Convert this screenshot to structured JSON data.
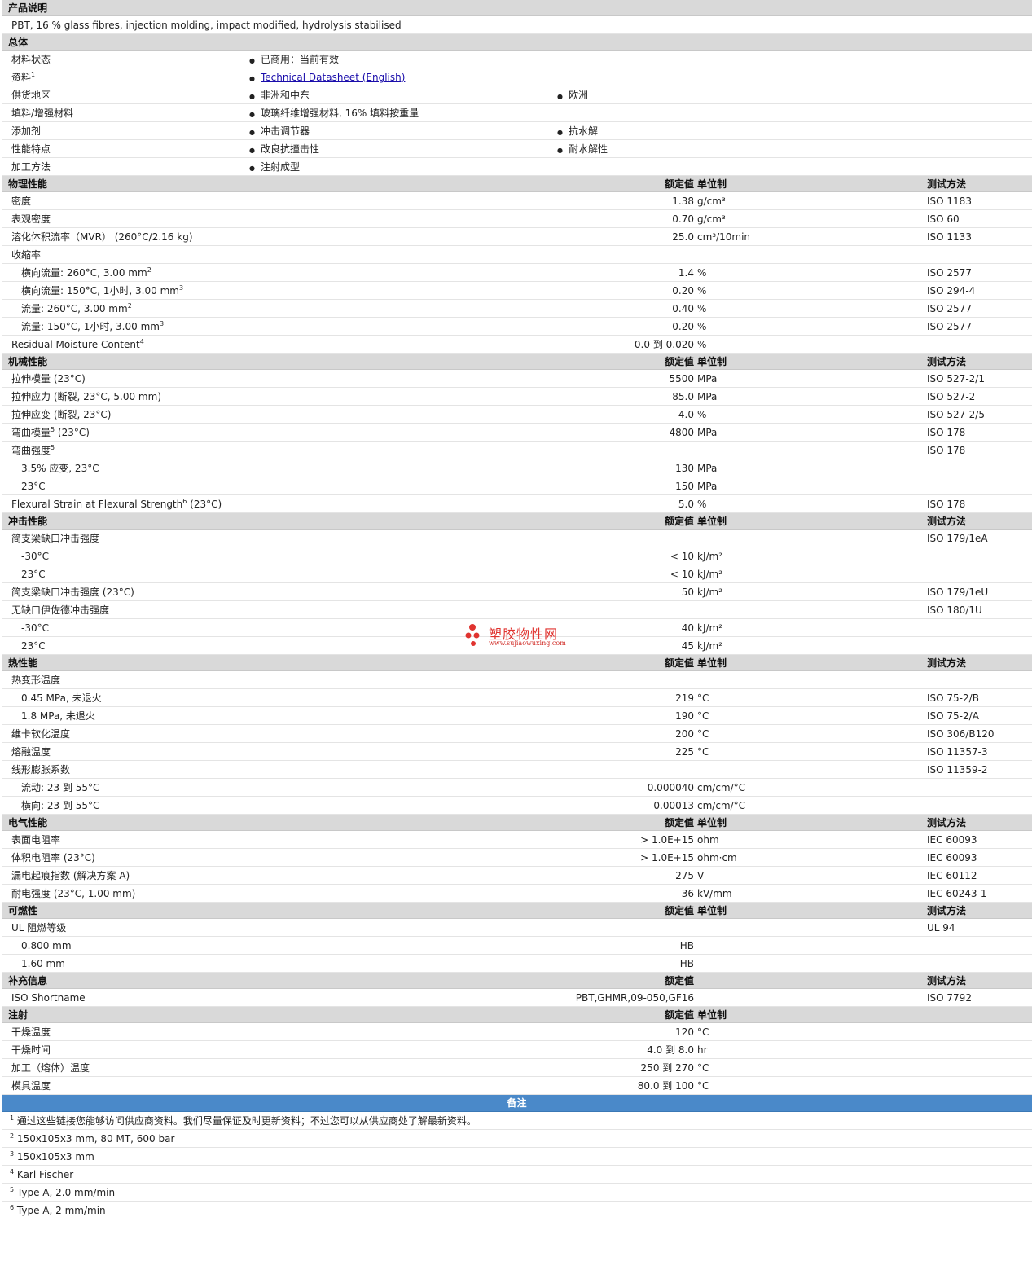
{
  "sections": [
    {
      "type": "section",
      "title": "产品说明"
    },
    {
      "type": "text",
      "text": "PBT, 16 % glass fibres, injection molding, impact modified, hydrolysis stabilised"
    },
    {
      "type": "section",
      "title": "总体"
    },
    {
      "type": "general",
      "label": "材料状态",
      "b1": "已商用：当前有效"
    },
    {
      "type": "general",
      "label": "资料",
      "sup": "1",
      "b1": "Technical Datasheet (English)",
      "link": true
    },
    {
      "type": "general",
      "label": "供货地区",
      "b1": "非洲和中东",
      "b2": "欧洲"
    },
    {
      "type": "general",
      "label": "填料/增强材料",
      "b1": "玻璃纤维增强材料, 16% 填料按重量"
    },
    {
      "type": "general",
      "label": "添加剂",
      "b1": "冲击调节器",
      "b2": "抗水解"
    },
    {
      "type": "general",
      "label": "性能特点",
      "b1": "改良抗撞击性",
      "b2": "耐水解性"
    },
    {
      "type": "general",
      "label": "加工方法",
      "b1": "注射成型"
    },
    {
      "type": "section",
      "title": "物理性能",
      "val": "额定值",
      "unit": "单位制",
      "test": "测试方法"
    },
    {
      "type": "prop",
      "label": "密度",
      "val": "1.38",
      "unit": "g/cm³",
      "test": "ISO 1183"
    },
    {
      "type": "prop",
      "label": "表观密度",
      "val": "0.70",
      "unit": "g/cm³",
      "test": "ISO 60"
    },
    {
      "type": "prop",
      "label": "溶化体积流率（MVR） (260°C/2.16 kg)",
      "val": "25.0",
      "unit": "cm³/10min",
      "test": "ISO 1133"
    },
    {
      "type": "prop",
      "label": "收缩率"
    },
    {
      "type": "prop",
      "sub": true,
      "label": "横向流量: 260°C, 3.00 mm",
      "sup": "2",
      "val": "1.4",
      "unit": "%",
      "test": "ISO 2577"
    },
    {
      "type": "prop",
      "sub": true,
      "label": "横向流量: 150°C, 1小时, 3.00 mm",
      "sup": "3",
      "val": "0.20",
      "unit": "%",
      "test": "ISO 294-4"
    },
    {
      "type": "prop",
      "sub": true,
      "label": "流量: 260°C, 3.00 mm",
      "sup": "2",
      "val": "0.40",
      "unit": "%",
      "test": "ISO 2577"
    },
    {
      "type": "prop",
      "sub": true,
      "label": "流量: 150°C, 1小时, 3.00 mm",
      "sup": "3",
      "val": "0.20",
      "unit": "%",
      "test": "ISO 2577"
    },
    {
      "type": "prop",
      "label": "Residual Moisture Content",
      "sup": "4",
      "val": "0.0 到  0.020",
      "unit": "%"
    },
    {
      "type": "section",
      "title": "机械性能",
      "val": "额定值",
      "unit": "单位制",
      "test": "测试方法"
    },
    {
      "type": "prop",
      "label": "拉伸模量 (23°C)",
      "val": "5500",
      "unit": "MPa",
      "test": "ISO 527-2/1"
    },
    {
      "type": "prop",
      "label": "拉伸应力 (断裂, 23°C, 5.00 mm)",
      "val": "85.0",
      "unit": "MPa",
      "test": "ISO 527-2"
    },
    {
      "type": "prop",
      "label": "拉伸应变 (断裂, 23°C)",
      "val": "4.0",
      "unit": "%",
      "test": "ISO 527-2/5"
    },
    {
      "type": "prop",
      "label": "弯曲模量",
      "sup": "5",
      "after": " (23°C)",
      "val": "4800",
      "unit": "MPa",
      "test": "ISO 178"
    },
    {
      "type": "prop",
      "label": "弯曲强度",
      "sup": "5",
      "test": "ISO 178"
    },
    {
      "type": "prop",
      "sub": true,
      "label": "3.5% 应变, 23°C",
      "val": "130",
      "unit": "MPa"
    },
    {
      "type": "prop",
      "sub": true,
      "label": "23°C",
      "val": "150",
      "unit": "MPa"
    },
    {
      "type": "prop",
      "label": "Flexural Strain at Flexural Strength",
      "sup": "6",
      "after": " (23°C)",
      "val": "5.0",
      "unit": "%",
      "test": "ISO 178"
    },
    {
      "type": "section",
      "title": "冲击性能",
      "val": "额定值",
      "unit": "单位制",
      "test": "测试方法"
    },
    {
      "type": "prop",
      "label": "简支梁缺口冲击强度",
      "test": "ISO 179/1eA"
    },
    {
      "type": "prop",
      "sub": true,
      "label": "-30°C",
      "val": "< 10",
      "unit": "kJ/m²"
    },
    {
      "type": "prop",
      "sub": true,
      "label": "23°C",
      "val": "< 10",
      "unit": "kJ/m²"
    },
    {
      "type": "prop",
      "label": "简支梁缺口冲击强度 (23°C)",
      "val": "50",
      "unit": "kJ/m²",
      "test": "ISO 179/1eU"
    },
    {
      "type": "prop",
      "label": "无缺口伊佐德冲击强度",
      "test": "ISO 180/1U"
    },
    {
      "type": "prop",
      "sub": true,
      "label": "-30°C",
      "val": "40",
      "unit": "kJ/m²"
    },
    {
      "type": "prop",
      "sub": true,
      "label": "23°C",
      "val": "45",
      "unit": "kJ/m²"
    },
    {
      "type": "section",
      "title": "热性能",
      "val": "额定值",
      "unit": "单位制",
      "test": "测试方法"
    },
    {
      "type": "prop",
      "label": "热变形温度"
    },
    {
      "type": "prop",
      "sub": true,
      "label": "0.45 MPa, 未退火",
      "val": "219",
      "unit": "°C",
      "test": "ISO 75-2/B"
    },
    {
      "type": "prop",
      "sub": true,
      "label": "1.8 MPa, 未退火",
      "val": "190",
      "unit": "°C",
      "test": "ISO 75-2/A"
    },
    {
      "type": "prop",
      "label": "维卡软化温度",
      "val": "200",
      "unit": "°C",
      "test": "ISO 306/B120"
    },
    {
      "type": "prop",
      "label": "熔融温度",
      "val": "225",
      "unit": "°C",
      "test": "ISO 11357-3"
    },
    {
      "type": "prop",
      "label": "线形膨胀系数",
      "test": "ISO 11359-2"
    },
    {
      "type": "prop",
      "sub": true,
      "label": "流动: 23 到  55°C",
      "val": "0.000040",
      "unit": "cm/cm/°C"
    },
    {
      "type": "prop",
      "sub": true,
      "label": "横向: 23 到  55°C",
      "val": "0.00013",
      "unit": "cm/cm/°C"
    },
    {
      "type": "section",
      "title": "电气性能",
      "val": "额定值",
      "unit": "单位制",
      "test": "测试方法"
    },
    {
      "type": "prop",
      "label": "表面电阻率",
      "val": "> 1.0E+15",
      "unit": "ohm",
      "test": "IEC 60093"
    },
    {
      "type": "prop",
      "label": "体积电阻率 (23°C)",
      "val": "> 1.0E+15",
      "unit": "ohm·cm",
      "test": "IEC 60093"
    },
    {
      "type": "prop",
      "label": "漏电起痕指数 (解决方案 A)",
      "val": "275",
      "unit": "V",
      "test": "IEC 60112"
    },
    {
      "type": "prop",
      "label": "耐电强度 (23°C, 1.00 mm)",
      "val": "36",
      "unit": "kV/mm",
      "test": "IEC 60243-1"
    },
    {
      "type": "section",
      "title": "可燃性",
      "val": "额定值",
      "unit": "单位制",
      "test": "测试方法"
    },
    {
      "type": "prop",
      "label": "UL 阻燃等级",
      "test": "UL 94"
    },
    {
      "type": "prop",
      "sub": true,
      "label": "0.800 mm",
      "val": "HB"
    },
    {
      "type": "prop",
      "sub": true,
      "label": "1.60 mm",
      "val": "HB"
    },
    {
      "type": "section",
      "title": "补充信息",
      "val": "额定值",
      "test": "测试方法"
    },
    {
      "type": "prop",
      "label": "ISO Shortname",
      "val": "PBT,GHMR,09-050,GF16",
      "test": "ISO 7792"
    },
    {
      "type": "section",
      "title": "注射",
      "val": "额定值",
      "unit": "单位制"
    },
    {
      "type": "prop",
      "label": "干燥温度",
      "val": "120",
      "unit": "°C"
    },
    {
      "type": "prop",
      "label": "干燥时间",
      "val": "4.0 到  8.0",
      "unit": "hr"
    },
    {
      "type": "prop",
      "label": "加工（熔体）温度",
      "val": "250 到  270",
      "unit": "°C"
    },
    {
      "type": "prop",
      "label": "模具温度",
      "val": "80.0 到  100",
      "unit": "°C"
    },
    {
      "type": "notes",
      "title": "备注"
    },
    {
      "type": "note",
      "num": "1",
      "text": "通过这些链接您能够访问供应商资料。我们尽量保证及时更新资料；不过您可以从供应商处了解最新资料。"
    },
    {
      "type": "note",
      "num": "2",
      "text": "150x105x3 mm, 80 MT, 600 bar"
    },
    {
      "type": "note",
      "num": "3",
      "text": "150x105x3 mm"
    },
    {
      "type": "note",
      "num": "4",
      "text": "Karl Fischer"
    },
    {
      "type": "note",
      "num": "5",
      "text": "Type A, 2.0 mm/min"
    },
    {
      "type": "note",
      "num": "6",
      "text": "Type A, 2 mm/min"
    }
  ],
  "watermark": {
    "name": "塑胶物性网",
    "url": "www.sujiaowuxing.com",
    "color": "#e0332f"
  }
}
